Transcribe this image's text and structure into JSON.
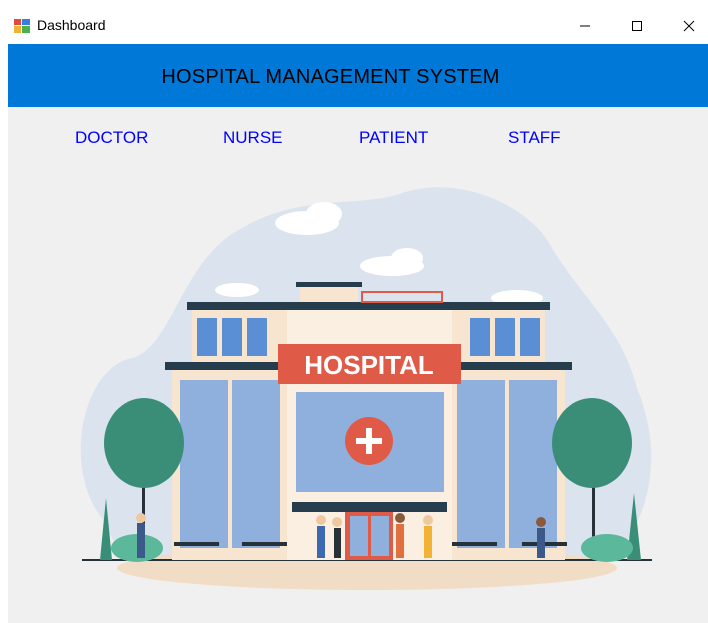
{
  "window": {
    "title": "Dashboard"
  },
  "header": {
    "title": "HOSPITAL MANAGEMENT SYSTEM"
  },
  "nav": {
    "doctor": "DOCTOR",
    "nurse": "NURSE",
    "patient": "PATIENT",
    "staff": "STAFF"
  },
  "illustration": {
    "sign": "HOSPITAL"
  },
  "colors": {
    "header_blue": "#0078d7",
    "nav_link": "#0000ff",
    "sign_red": "#df5a47",
    "tree_green": "#3a8e78"
  },
  "icons": {
    "app": "dashboard-app-icon",
    "minimize": "minimize-icon",
    "maximize": "maximize-icon",
    "close": "close-icon"
  }
}
